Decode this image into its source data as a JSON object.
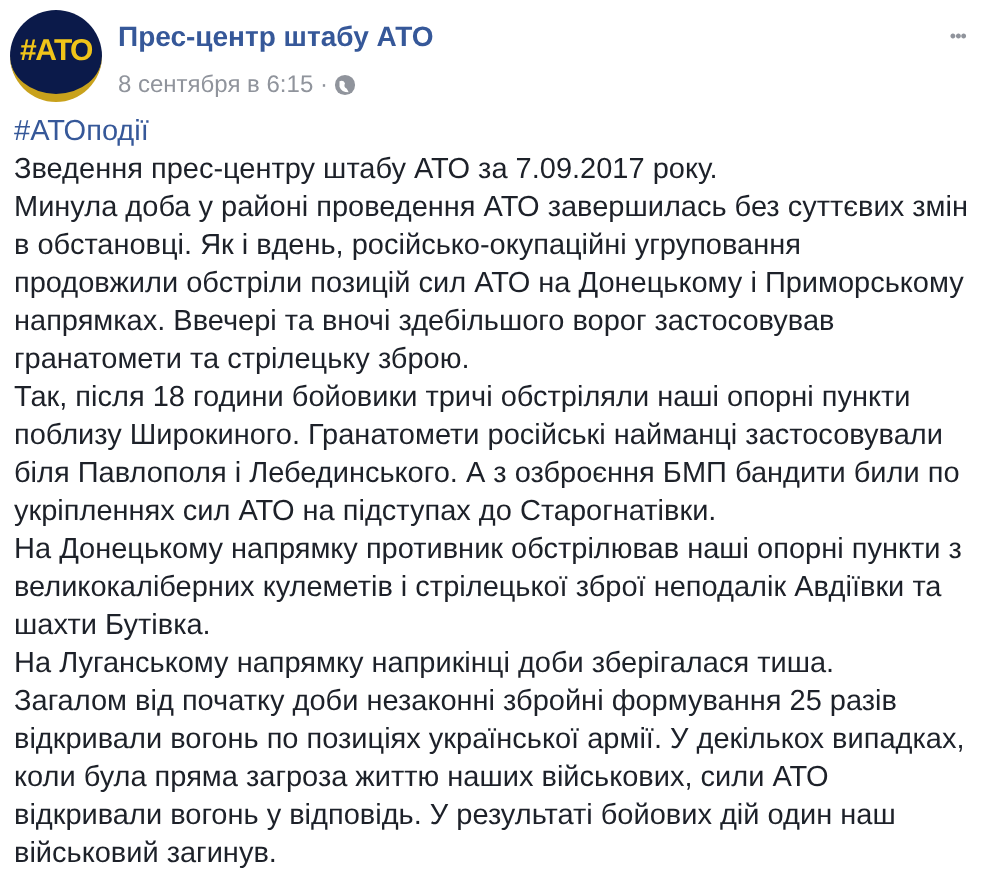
{
  "post": {
    "avatar_text": "#АТО",
    "author": "Прес-центр штабу АТО",
    "time": "8 сентября в 6:15 ·",
    "menu": "•••",
    "hashtag": "#АТОподії",
    "paragraphs": [
      "Зведення прес-центру штабу АТО за 7.09.2017 року.",
      "Минула доба у районі проведення АТО завершилась без суттєвих змін в обстановці. Як і вдень, російсько-окупаційні угруповання продовжили обстріли позицій сил АТО на Донецькому і Приморському напрямках. Ввечері та вночі здебільшого ворог застосовував гранатомети та стрілецьку зброю.",
      "Так, після 18 години бойовики тричі обстріляли наші опорні пункти поблизу Широкиного. Гранатомети російські найманці застосовували біля Павлополя і Лебединського. А з озброєння БМП бандити били по укріпленнях сил АТО на підступах до Старогнатівки.",
      "На Донецькому напрямку противник обстрілював наші опорні пункти з великокаліберних кулеметів і стрілецької зброї неподалік Авдіївки та шахти Бутівка.",
      "На Луганському напрямку наприкінці доби зберігалася тиша.",
      "Загалом від початку доби незаконні збройні формування 25 разів відкривали вогонь по позиціях української армії. У декількох випадках, коли була пряма загроза життю наших військових, сили АТО відкривали вогонь у відповідь. У результаті бойових дій один наш військовий загинув."
    ]
  }
}
